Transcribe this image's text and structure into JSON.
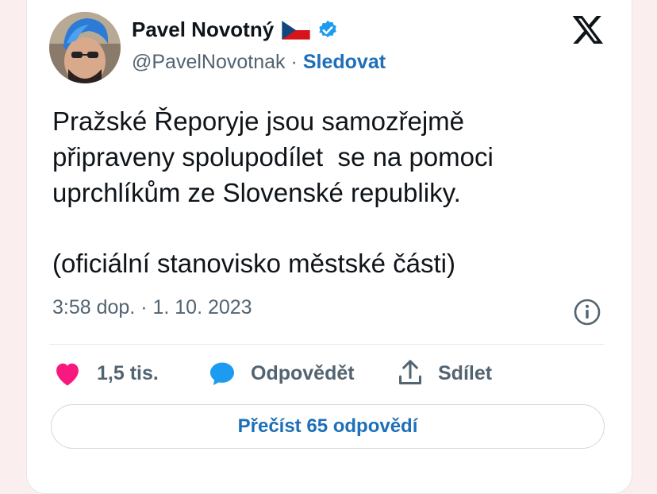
{
  "author": {
    "name": "Pavel Novotný",
    "handle": "@PavelNovotnak",
    "separator": "·",
    "follow_label": "Sledovat",
    "flag_icon": "czech-flag-icon",
    "verified_icon": "verified-badge-icon",
    "verified_color": "#1d9bf0"
  },
  "platform_icon": "x-logo-icon",
  "tweet": {
    "text": "Pražské Řeporyje jsou samozřejmě\npřipraveny spolupodílet  se na pomoci\nuprchlíkům ze Slovenské republiky.",
    "text2": "(oficiální stanovisko městské části)",
    "timestamp": "3:58 dop. · 1. 10. 2023"
  },
  "actions": {
    "like_count": "1,5 tis.",
    "reply_label": "Odpovědět",
    "share_label": "Sdílet",
    "like_color": "#f91880",
    "reply_color": "#1d9bf0"
  },
  "read_replies_label": "Přečíst 65 odpovědí",
  "colors": {
    "accent_text": "#1d6fb8",
    "secondary_text": "#536471",
    "background": "#fbeeee"
  }
}
